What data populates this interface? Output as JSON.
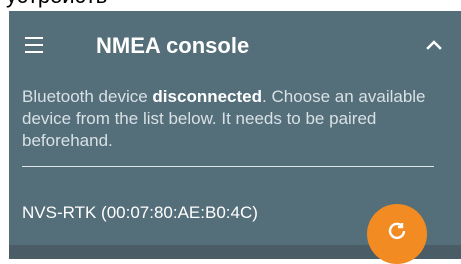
{
  "top_caption": "устройств",
  "toolbar": {
    "title": "NMEA console",
    "menu_icon": "hamburger-menu-icon",
    "collapse_icon": "chevron-up-icon"
  },
  "status": {
    "prefix": "Bluetooth device ",
    "state": "disconnected",
    "suffix": ". Choose an available device from the list below. It needs to be paired beforehand."
  },
  "devices": [
    {
      "label": "NVS-RTK (00:07:80:AE:B0:4C)"
    }
  ],
  "fab": {
    "icon": "refresh-icon",
    "color": "#f28b22"
  },
  "colors": {
    "panel": "#546e7a",
    "accent": "#f28b22",
    "text": "#ffffff"
  }
}
